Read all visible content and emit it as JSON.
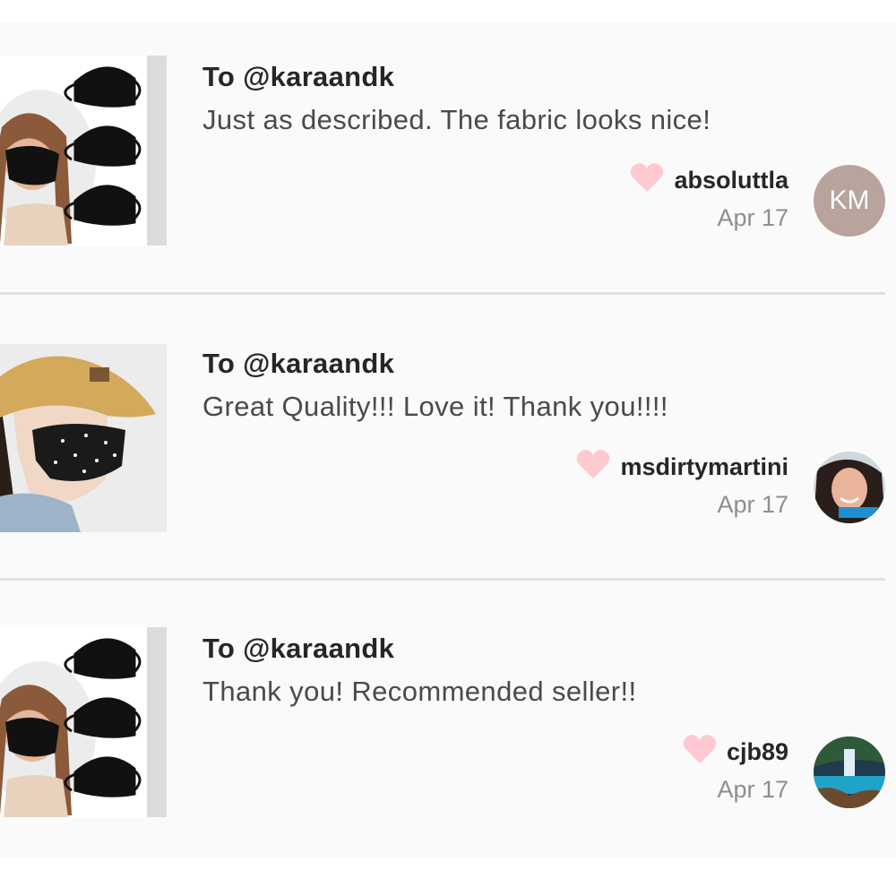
{
  "reviews": [
    {
      "recipient": "To @karaandk",
      "message": "Just as described. The fabric looks nice!",
      "username": "absoluttla",
      "date": "Apr 17",
      "avatar_initials": "KM",
      "avatar_color": "#b9a39d",
      "thumbnail": "black-face-masks-product"
    },
    {
      "recipient": "To @karaandk",
      "message": "Great Quality!!! Love it! Thank you!!!!",
      "username": "msdirtymartini",
      "date": "Apr 17",
      "avatar": "user-photo",
      "thumbnail": "star-print-mask-with-cap-product"
    },
    {
      "recipient": "To @karaandk",
      "message": "Thank you! Recommended seller!!",
      "username": "cjb89",
      "date": "Apr 17",
      "avatar": "waterfall-photo",
      "thumbnail": "black-face-masks-product"
    }
  ],
  "colors": {
    "heart": "#ffc9d1",
    "divider": "#e4dee0",
    "background": "#fafafa"
  }
}
